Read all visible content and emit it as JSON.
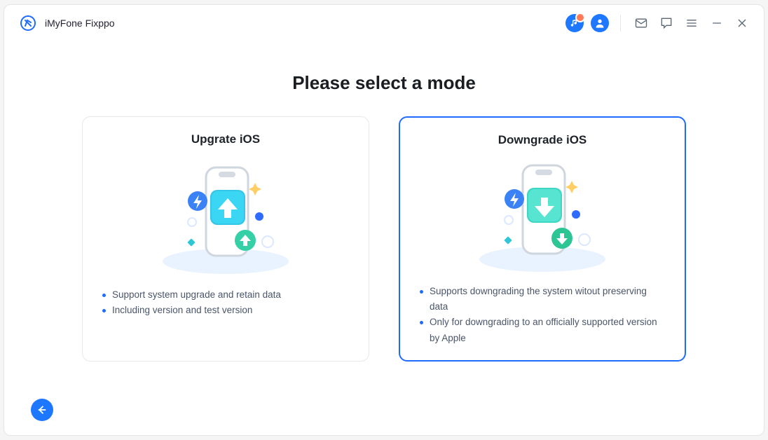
{
  "app": {
    "title": "iMyFone Fixppo"
  },
  "page": {
    "heading": "Please select a mode"
  },
  "cards": {
    "upgrade": {
      "title": "Upgrate iOS",
      "bullets": [
        "Support system upgrade and retain data",
        "Including version and test version"
      ],
      "selected": false
    },
    "downgrade": {
      "title": "Downgrade iOS",
      "bullets": [
        "Supports downgrading the system witout preserving data",
        "Only for downgrading to an officially supported version by Apple"
      ],
      "selected": true
    }
  }
}
